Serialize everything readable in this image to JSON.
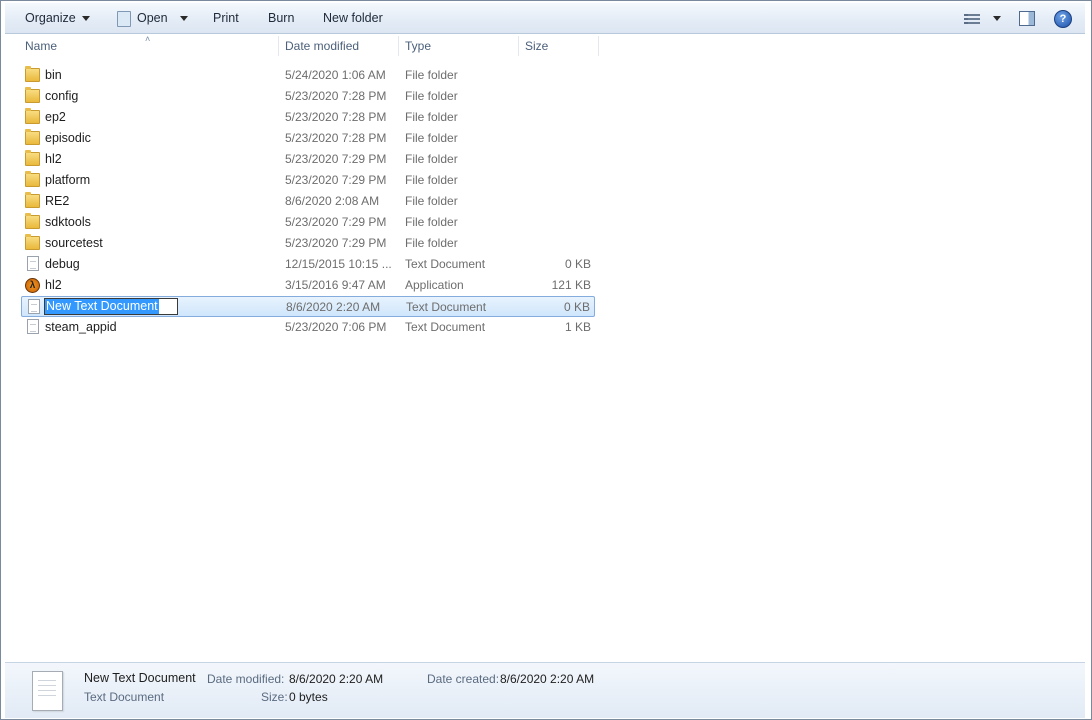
{
  "toolbar": {
    "organize": "Organize",
    "open": "Open",
    "print": "Print",
    "burn": "Burn",
    "new_folder": "New folder",
    "help": "?"
  },
  "columns": {
    "name": "Name",
    "date": "Date modified",
    "type": "Type",
    "size": "Size"
  },
  "files": [
    {
      "name": "bin",
      "date": "5/24/2020 1:06 AM",
      "type": "File folder",
      "size": "",
      "icon": "folder-icon"
    },
    {
      "name": "config",
      "date": "5/23/2020 7:28 PM",
      "type": "File folder",
      "size": "",
      "icon": "folder-icon"
    },
    {
      "name": "ep2",
      "date": "5/23/2020 7:28 PM",
      "type": "File folder",
      "size": "",
      "icon": "folder-icon"
    },
    {
      "name": "episodic",
      "date": "5/23/2020 7:28 PM",
      "type": "File folder",
      "size": "",
      "icon": "folder-icon"
    },
    {
      "name": "hl2",
      "date": "5/23/2020 7:29 PM",
      "type": "File folder",
      "size": "",
      "icon": "folder-icon"
    },
    {
      "name": "platform",
      "date": "5/23/2020 7:29 PM",
      "type": "File folder",
      "size": "",
      "icon": "folder-icon"
    },
    {
      "name": "RE2",
      "date": "8/6/2020 2:08 AM",
      "type": "File folder",
      "size": "",
      "icon": "folder-icon"
    },
    {
      "name": "sdktools",
      "date": "5/23/2020 7:29 PM",
      "type": "File folder",
      "size": "",
      "icon": "folder-icon"
    },
    {
      "name": "sourcetest",
      "date": "5/23/2020 7:29 PM",
      "type": "File folder",
      "size": "",
      "icon": "folder-icon"
    },
    {
      "name": "debug",
      "date": "12/15/2015 10:15 ...",
      "type": "Text Document",
      "size": "0 KB",
      "icon": "text-document-icon"
    },
    {
      "name": "hl2",
      "date": "3/15/2016 9:47 AM",
      "type": "Application",
      "size": "121 KB",
      "icon": "half-life-app-icon"
    },
    {
      "name": "New Text Document",
      "date": "8/6/2020 2:20 AM",
      "type": "Text Document",
      "size": "0 KB",
      "icon": "text-document-icon"
    },
    {
      "name": "steam_appid",
      "date": "5/23/2020 7:06 PM",
      "type": "Text Document",
      "size": "1 KB",
      "icon": "text-document-icon"
    }
  ],
  "selected_index": 11,
  "details": {
    "name": "New Text Document",
    "type": "Text Document",
    "modified_label": "Date modified:",
    "modified_value": "8/6/2020 2:20 AM",
    "created_label": "Date created:",
    "created_value": "8/6/2020 2:20 AM",
    "size_label": "Size:",
    "size_value": "0 bytes"
  },
  "colors": {
    "selection": "#cfe6fc",
    "rename_highlight": "#3399ff"
  }
}
